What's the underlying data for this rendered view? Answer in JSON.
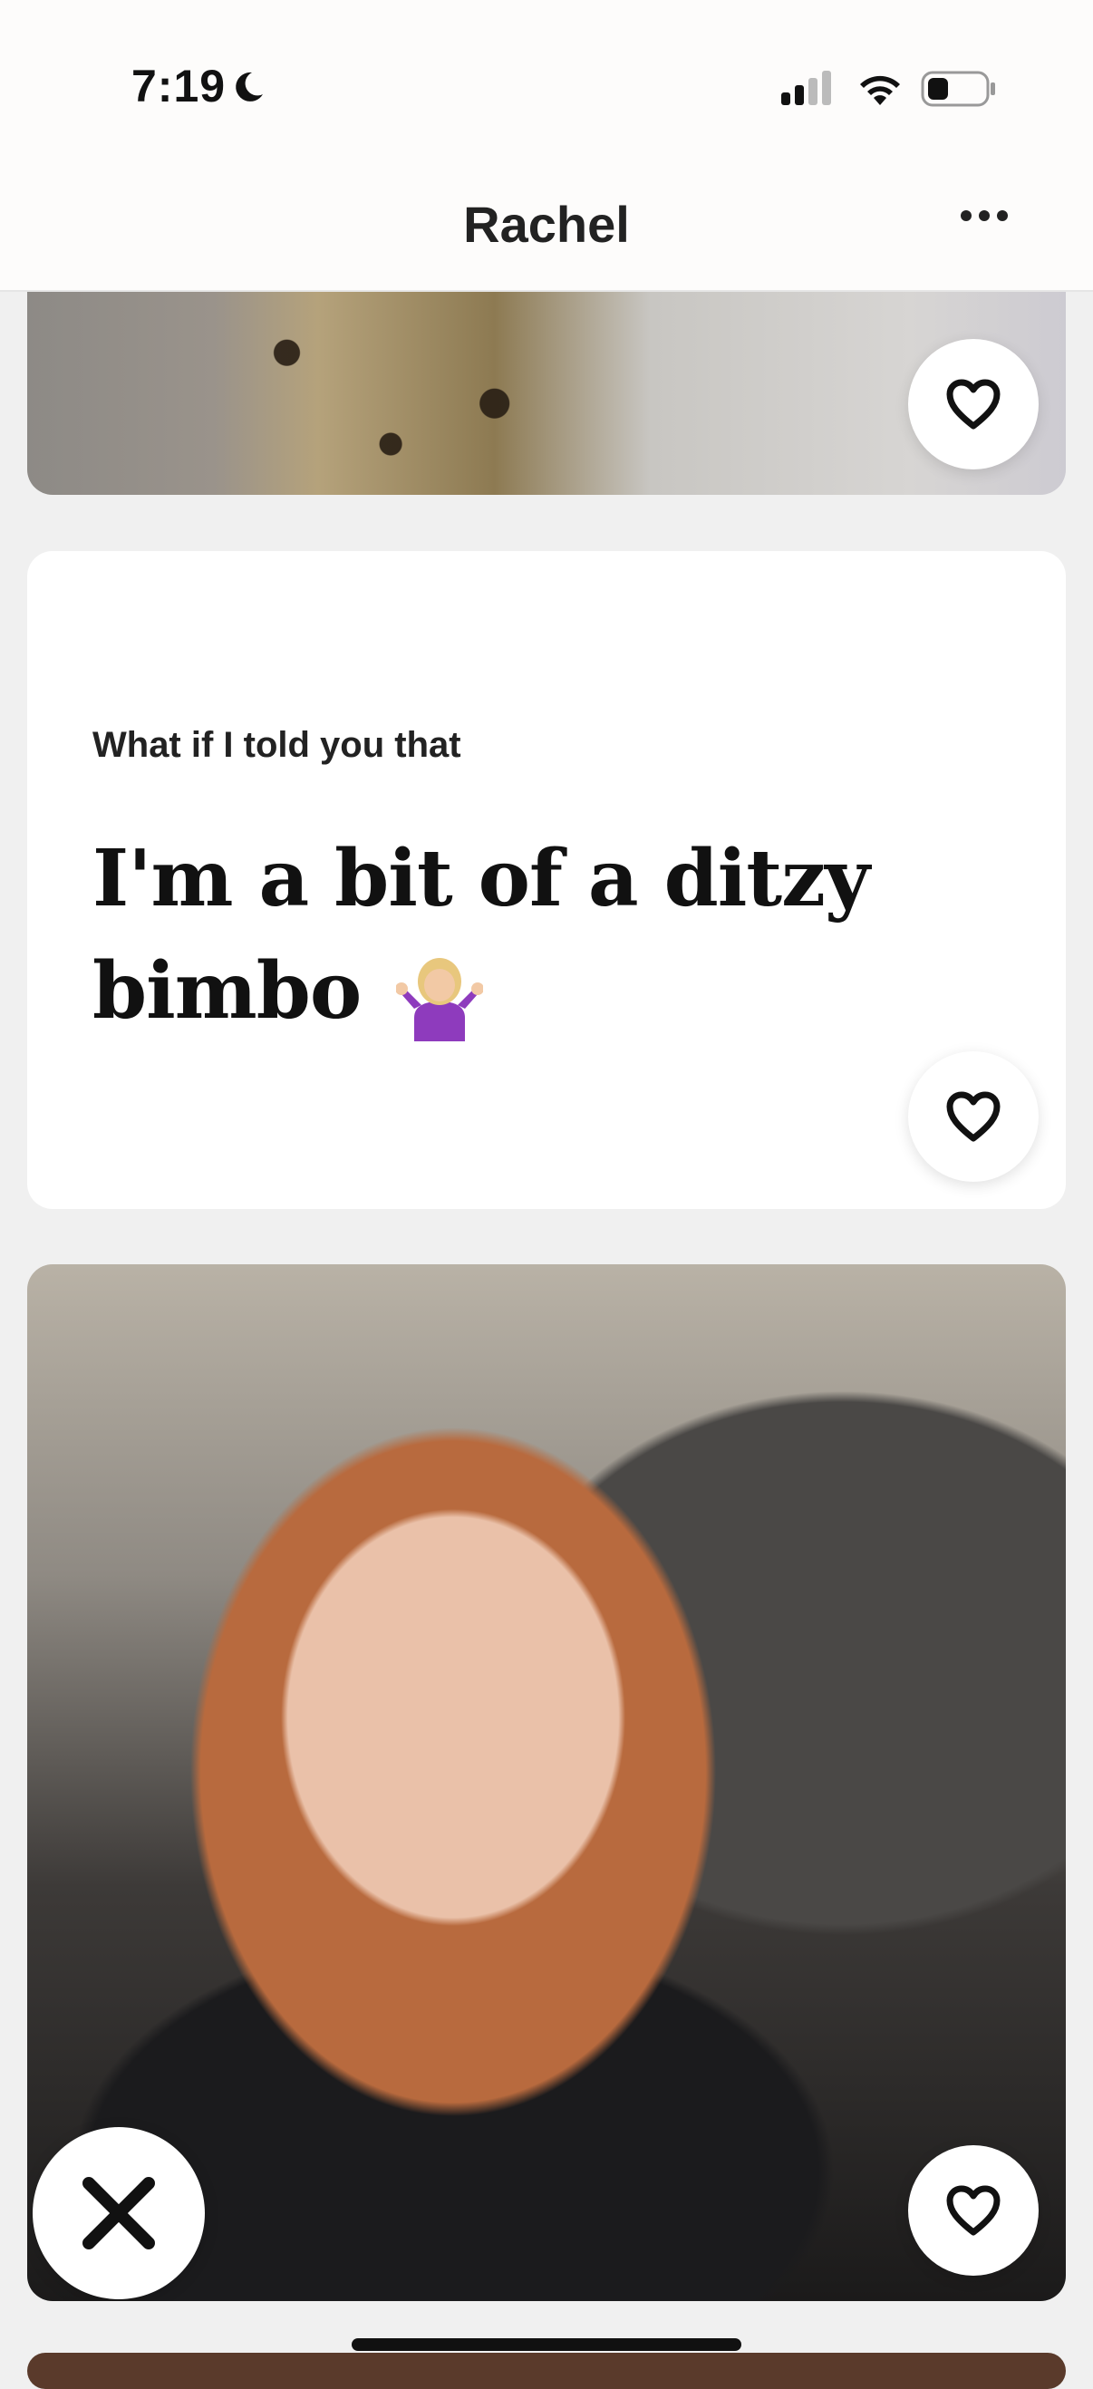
{
  "status": {
    "time": "7:19"
  },
  "header": {
    "title": "Rachel"
  },
  "prompt": {
    "label": "What if I told you that",
    "answer": "I'm a bit of a ditzy bimbo"
  },
  "icons": {
    "like": "heart-icon",
    "skip": "close-icon",
    "more": "more-dots-icon"
  },
  "colors": {
    "text": "#111111",
    "card": "#ffffff",
    "background": "#f0f0f0"
  }
}
